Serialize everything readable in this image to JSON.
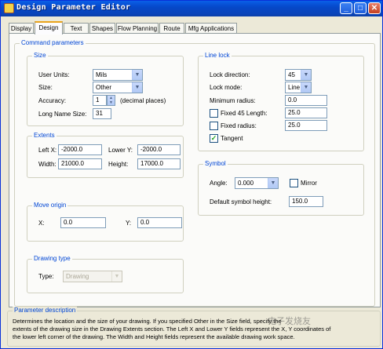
{
  "window": {
    "title": "Design Parameter Editor",
    "minimize_glyph": "_",
    "maximize_glyph": "□",
    "close_glyph": "✕"
  },
  "tabs": [
    {
      "label": "Display"
    },
    {
      "label": "Design"
    },
    {
      "label": "Text"
    },
    {
      "label": "Shapes"
    },
    {
      "label": "Flow Planning"
    },
    {
      "label": "Route"
    },
    {
      "label": "Mfg Applications"
    }
  ],
  "command_parameters": {
    "title": "Command parameters",
    "size": {
      "title": "Size",
      "user_units_label": "User Units:",
      "user_units_value": "Mils",
      "size_label": "Size:",
      "size_value": "Other",
      "accuracy_label": "Accuracy:",
      "accuracy_value": "1",
      "accuracy_unit": "(decimal places)",
      "long_name_label": "Long Name Size:",
      "long_name_value": "31"
    },
    "extents": {
      "title": "Extents",
      "left_x_label": "Left X:",
      "left_x_value": "-2000.0",
      "lower_y_label": "Lower Y:",
      "lower_y_value": "-2000.0",
      "width_label": "Width:",
      "width_value": "21000.0",
      "height_label": "Height:",
      "height_value": "17000.0"
    },
    "move_origin": {
      "title": "Move origin",
      "x_label": "X:",
      "x_value": "0.0",
      "y_label": "Y:",
      "y_value": "0.0"
    },
    "drawing_type": {
      "title": "Drawing type",
      "type_label": "Type:",
      "type_value": "Drawing"
    },
    "line_lock": {
      "title": "Line lock",
      "lock_direction_label": "Lock direction:",
      "lock_direction_value": "45",
      "lock_mode_label": "Lock mode:",
      "lock_mode_value": "Line",
      "min_radius_label": "Minimum radius:",
      "min_radius_value": "0.0",
      "fixed45_label": "Fixed 45 Length:",
      "fixed45_checked": false,
      "fixed45_value": "25.0",
      "fixed_radius_label": "Fixed radius:",
      "fixed_radius_checked": false,
      "fixed_radius_value": "25.0",
      "tangent_label": "Tangent",
      "tangent_checked": true,
      "check_glyph": "✓"
    },
    "symbol": {
      "title": "Symbol",
      "angle_label": "Angle:",
      "angle_value": "0.000",
      "mirror_label": "Mirror",
      "mirror_checked": false,
      "default_height_label": "Default symbol height:",
      "default_height_value": "150.0"
    }
  },
  "parameter_description": {
    "title": "Parameter description",
    "lines": [
      "Determines the location and the size of your drawing.  If you specified Other in the Size field, specify the",
      "extents of the drawing size in the Drawing Extents section. The Left X and Lower Y fields represent the X, Y coordinates of",
      "the lower left corner of the drawing. The Width and Height fields represent the available drawing work space."
    ]
  },
  "watermark": "电子发烧友"
}
